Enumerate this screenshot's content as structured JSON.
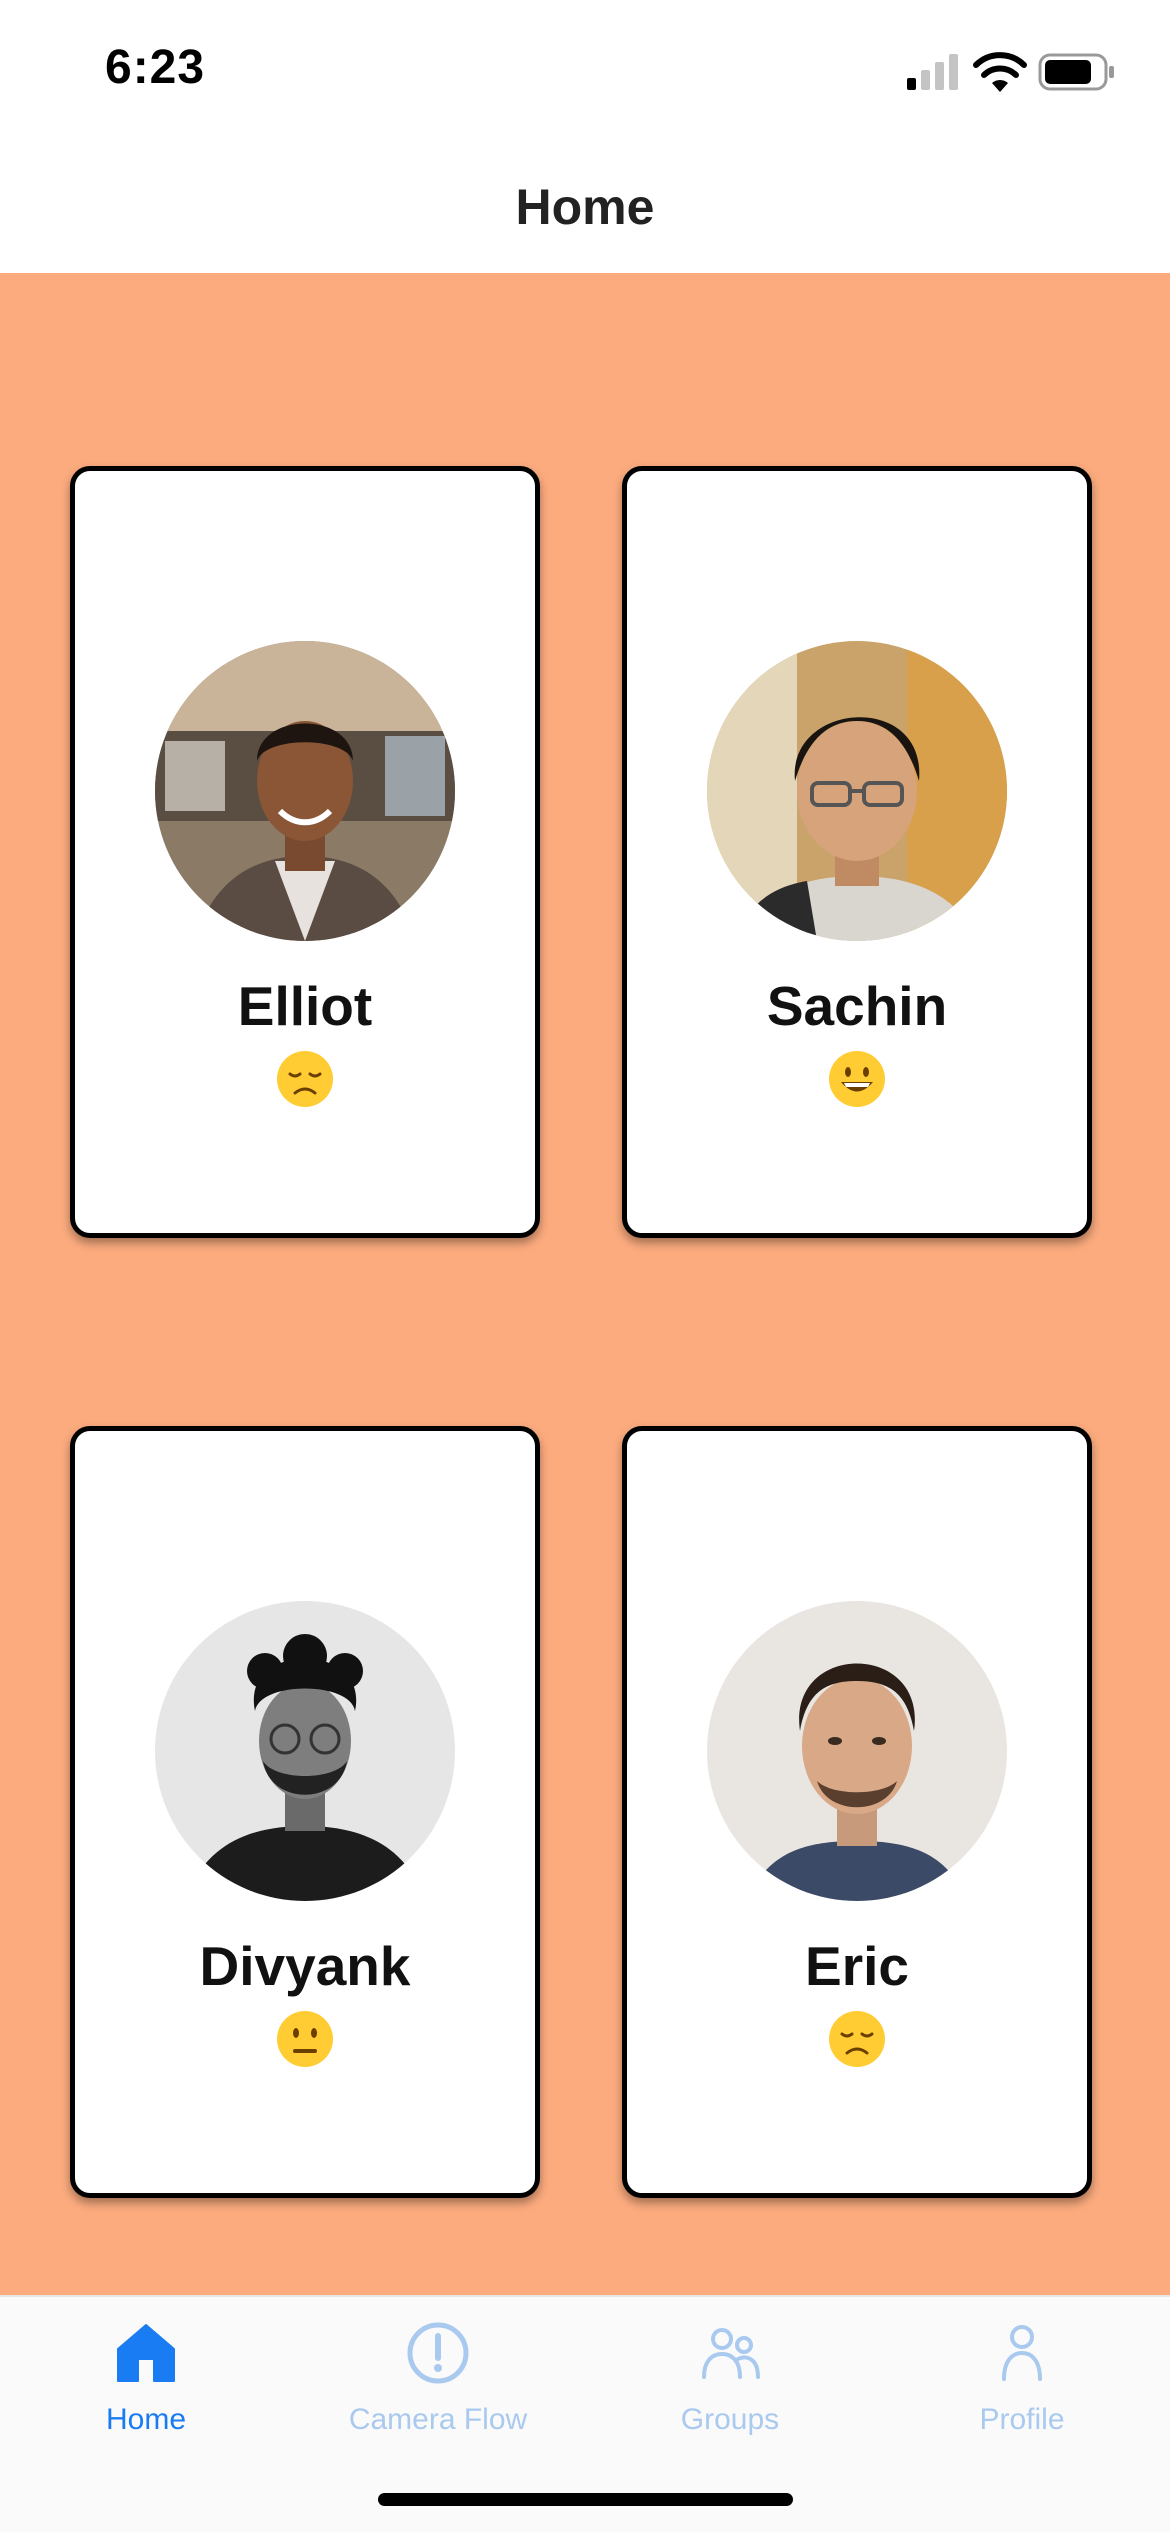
{
  "status_bar": {
    "time": "6:23",
    "icons": [
      "signal-icon",
      "wifi-icon",
      "battery-icon"
    ]
  },
  "header": {
    "title": "Home"
  },
  "colors": {
    "content_background": "#fbab7e",
    "card_background": "#ffffff",
    "card_border": "#000000",
    "tab_active": "#1a7cf2",
    "tab_inactive": "#a9c9ef"
  },
  "people": [
    {
      "name": "Elliot",
      "mood": "disappointed-face-emoji"
    },
    {
      "name": "Sachin",
      "mood": "grinning-face-emoji"
    },
    {
      "name": "Divyank",
      "mood": "neutral-face-emoji"
    },
    {
      "name": "Eric",
      "mood": "disappointed-face-emoji"
    }
  ],
  "tab_bar": {
    "selected": "Home",
    "tabs": [
      {
        "label": "Home",
        "icon": "home-icon"
      },
      {
        "label": "Camera Flow",
        "icon": "exclamation-circle-icon"
      },
      {
        "label": "Groups",
        "icon": "people-icon"
      },
      {
        "label": "Profile",
        "icon": "person-icon"
      }
    ]
  }
}
